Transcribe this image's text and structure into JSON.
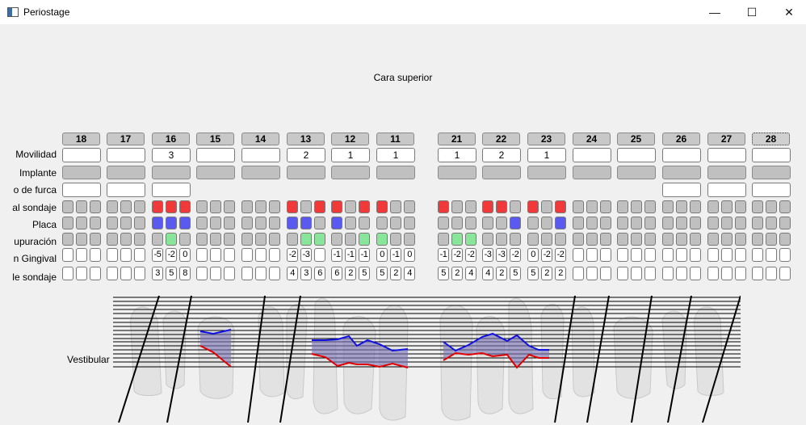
{
  "window": {
    "title": "Periostage",
    "minimize": "—",
    "maximize": "☐",
    "close": "✕"
  },
  "section_title": "Cara superior",
  "row_labels": [
    "Movilidad",
    "Implante",
    "o de furca",
    "al sondaje",
    "Placa",
    "upuración",
    "n Gingival",
    "le sondaje"
  ],
  "chart_label": "Vestibular",
  "colors": {
    "bleeding": "#f03a3a",
    "plaque": "#5a5af0",
    "suppuration": "#88e59a",
    "gray": "#c0c0c0",
    "gingival_line": "#e00000",
    "probing_line": "#1010e0",
    "fill": "#7b74b8"
  },
  "teeth": [
    {
      "num": "18",
      "mobility": "",
      "furca": true,
      "bleeding": [
        0,
        0,
        0
      ],
      "plaque": [
        0,
        0,
        0
      ],
      "suppuration": [
        0,
        0,
        0
      ],
      "gingival": [
        "",
        "",
        ""
      ],
      "probing": [
        "",
        "",
        ""
      ]
    },
    {
      "num": "17",
      "mobility": "",
      "furca": true,
      "bleeding": [
        0,
        0,
        0
      ],
      "plaque": [
        0,
        0,
        0
      ],
      "suppuration": [
        0,
        0,
        0
      ],
      "gingival": [
        "",
        "",
        ""
      ],
      "probing": [
        "",
        "",
        ""
      ]
    },
    {
      "num": "16",
      "mobility": "3",
      "furca": true,
      "bleeding": [
        1,
        1,
        1
      ],
      "plaque": [
        1,
        1,
        1
      ],
      "suppuration": [
        0,
        1,
        0
      ],
      "gingival": [
        "-5",
        "-2",
        "0"
      ],
      "probing": [
        "3",
        "5",
        "8"
      ]
    },
    {
      "num": "15",
      "mobility": "",
      "furca": false,
      "bleeding": [
        0,
        0,
        0
      ],
      "plaque": [
        0,
        0,
        0
      ],
      "suppuration": [
        0,
        0,
        0
      ],
      "gingival": [
        "",
        "",
        ""
      ],
      "probing": [
        "",
        "",
        ""
      ]
    },
    {
      "num": "14",
      "mobility": "",
      "furca": false,
      "bleeding": [
        0,
        0,
        0
      ],
      "plaque": [
        0,
        0,
        0
      ],
      "suppuration": [
        0,
        0,
        0
      ],
      "gingival": [
        "",
        "",
        ""
      ],
      "probing": [
        "",
        "",
        ""
      ]
    },
    {
      "num": "13",
      "mobility": "2",
      "furca": false,
      "bleeding": [
        1,
        0,
        1
      ],
      "plaque": [
        1,
        1,
        0
      ],
      "suppuration": [
        0,
        1,
        1
      ],
      "gingival": [
        "-2",
        "-3",
        ""
      ],
      "probing": [
        "4",
        "3",
        "6"
      ]
    },
    {
      "num": "12",
      "mobility": "1",
      "furca": false,
      "bleeding": [
        1,
        0,
        1
      ],
      "plaque": [
        1,
        0,
        0
      ],
      "suppuration": [
        0,
        0,
        1
      ],
      "gingival": [
        "-1",
        "-1",
        "-1"
      ],
      "probing": [
        "6",
        "2",
        "5"
      ]
    },
    {
      "num": "11",
      "mobility": "1",
      "furca": false,
      "bleeding": [
        1,
        0,
        0
      ],
      "plaque": [
        0,
        0,
        0
      ],
      "suppuration": [
        1,
        0,
        0
      ],
      "gingival": [
        "0",
        "-1",
        "0"
      ],
      "probing": [
        "5",
        "2",
        "4"
      ]
    },
    {
      "num": "21",
      "mobility": "1",
      "furca": false,
      "bleeding": [
        1,
        0,
        0
      ],
      "plaque": [
        0,
        0,
        0
      ],
      "suppuration": [
        0,
        1,
        1
      ],
      "gingival": [
        "-1",
        "-2",
        "-2"
      ],
      "probing": [
        "5",
        "2",
        "4"
      ]
    },
    {
      "num": "22",
      "mobility": "2",
      "furca": false,
      "bleeding": [
        1,
        1,
        0
      ],
      "plaque": [
        0,
        0,
        1
      ],
      "suppuration": [
        0,
        0,
        0
      ],
      "gingival": [
        "-3",
        "-3",
        "-2"
      ],
      "probing": [
        "4",
        "2",
        "5"
      ]
    },
    {
      "num": "23",
      "mobility": "1",
      "furca": false,
      "bleeding": [
        1,
        0,
        1
      ],
      "plaque": [
        0,
        0,
        1
      ],
      "suppuration": [
        0,
        0,
        0
      ],
      "gingival": [
        "0",
        "-2",
        "-2"
      ],
      "probing": [
        "5",
        "2",
        "2"
      ]
    },
    {
      "num": "24",
      "mobility": "",
      "furca": false,
      "bleeding": [
        0,
        0,
        0
      ],
      "plaque": [
        0,
        0,
        0
      ],
      "suppuration": [
        0,
        0,
        0
      ],
      "gingival": [
        "",
        "",
        ""
      ],
      "probing": [
        "",
        "",
        ""
      ]
    },
    {
      "num": "25",
      "mobility": "",
      "furca": false,
      "bleeding": [
        0,
        0,
        0
      ],
      "plaque": [
        0,
        0,
        0
      ],
      "suppuration": [
        0,
        0,
        0
      ],
      "gingival": [
        "",
        "",
        ""
      ],
      "probing": [
        "",
        "",
        ""
      ]
    },
    {
      "num": "26",
      "mobility": "",
      "furca": true,
      "bleeding": [
        0,
        0,
        0
      ],
      "plaque": [
        0,
        0,
        0
      ],
      "suppuration": [
        0,
        0,
        0
      ],
      "gingival": [
        "",
        "",
        ""
      ],
      "probing": [
        "",
        "",
        ""
      ]
    },
    {
      "num": "27",
      "mobility": "",
      "furca": true,
      "bleeding": [
        0,
        0,
        0
      ],
      "plaque": [
        0,
        0,
        0
      ],
      "suppuration": [
        0,
        0,
        0
      ],
      "gingival": [
        "",
        "",
        ""
      ],
      "probing": [
        "",
        "",
        ""
      ]
    },
    {
      "num": "28",
      "mobility": "",
      "furca": true,
      "bleeding": [
        0,
        0,
        0
      ],
      "plaque": [
        0,
        0,
        0
      ],
      "suppuration": [
        0,
        0,
        0
      ],
      "gingival": [
        "",
        "",
        ""
      ],
      "probing": [
        "",
        "",
        ""
      ]
    }
  ]
}
